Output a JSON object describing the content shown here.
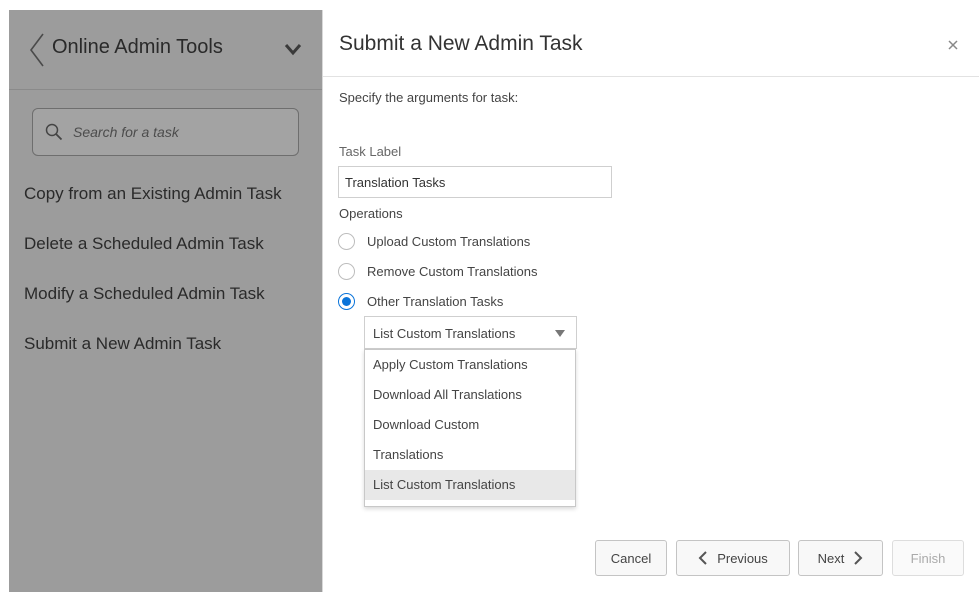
{
  "sidebar": {
    "title": "Online Admin Tools",
    "search": {
      "placeholder": "Search for a task",
      "value": ""
    },
    "items": [
      {
        "label": "Copy from an Existing Admin Task"
      },
      {
        "label": "Delete a Scheduled Admin Task"
      },
      {
        "label": "Modify a Scheduled Admin Task"
      },
      {
        "label": "Submit a New Admin Task"
      }
    ]
  },
  "dialog": {
    "title": "Submit a New Admin Task",
    "prompt": "Specify the arguments for task:",
    "task_label": {
      "label": "Task Label",
      "value": "Translation Tasks"
    },
    "operations": {
      "label": "Operations",
      "options": [
        {
          "label": "Upload Custom Translations",
          "checked": false
        },
        {
          "label": "Remove Custom Translations",
          "checked": false
        },
        {
          "label": "Other Translation Tasks",
          "checked": true
        }
      ]
    },
    "select": {
      "value": "List Custom Translations",
      "options": [
        {
          "label": "Apply Custom Translations"
        },
        {
          "label": "Download All Translations"
        },
        {
          "label": "Download Custom"
        },
        {
          "label": "Translations"
        },
        {
          "label": "List Custom Translations"
        }
      ]
    },
    "buttons": {
      "cancel": "Cancel",
      "previous": "Previous",
      "next": "Next",
      "finish": "Finish"
    }
  },
  "colors": {
    "sidebar_bg": "#9c9c9c",
    "radio_accent": "#0a74da",
    "dropdown_highlight": "#e8e8e8"
  }
}
